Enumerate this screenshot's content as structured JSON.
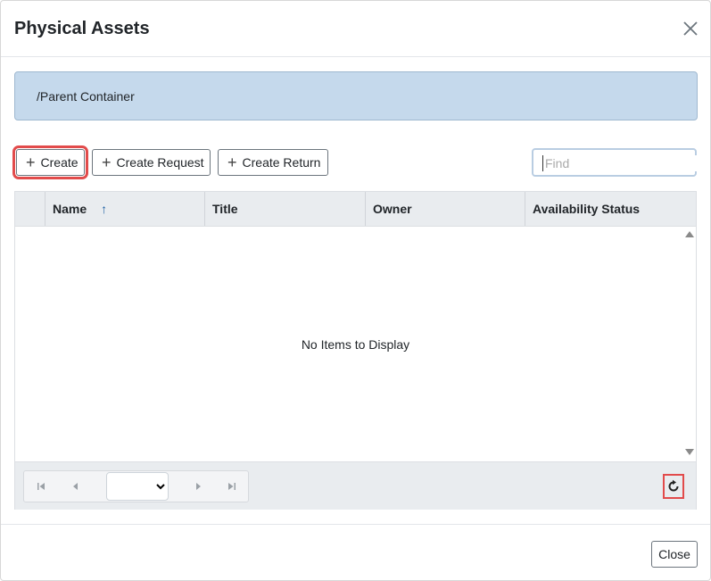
{
  "dialog": {
    "title": "Physical Assets"
  },
  "breadcrumb": {
    "path": "/Parent Container"
  },
  "toolbar": {
    "create_label": "Create",
    "create_request_label": "Create Request",
    "create_return_label": "Create Return"
  },
  "search": {
    "placeholder": "Find",
    "value": ""
  },
  "grid": {
    "columns": [
      "Name",
      "Title",
      "Owner",
      "Availability Status"
    ],
    "sort_indicator": "↑",
    "empty_message": "No Items to Display"
  },
  "pager": {
    "selected_page": ""
  },
  "footer": {
    "close_label": "Close"
  },
  "icons": {
    "close": "close-icon",
    "plus": "plus-icon",
    "first": "first-page-icon",
    "prev": "prev-page-icon",
    "next": "next-page-icon",
    "last": "last-page-icon",
    "refresh": "refresh-icon"
  },
  "colors": {
    "highlight": "#e24b4b",
    "breadcrumb_bg": "#c5d9ec",
    "sort_arrow": "#1b5fa3"
  }
}
